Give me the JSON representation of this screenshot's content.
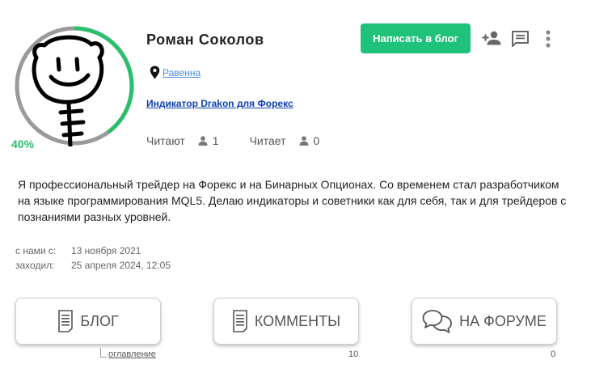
{
  "profile": {
    "name": "Роман Соколов",
    "progress_label": "40%",
    "progress": 0.4,
    "location": "Равенна",
    "product_link": "Индикатор Drakon для Форекс",
    "followers_label": "Читают",
    "followers_count": "1",
    "following_label": "Читает",
    "following_count": "0",
    "bio": "Я профессиональный трейдер на Форекс и на Бинарных Опционах. Со временем стал разработчиком на языке программирования MQL5. Делаю индикаторы и советники как для себя, так и для трейдеров с познаниями разных уровней.",
    "meta": [
      {
        "key": "с нами с:",
        "value": "13 ноября 2021"
      },
      {
        "key": "заходил:",
        "value": "25 апреля 2024, 12:05"
      }
    ]
  },
  "actions": {
    "write_blog": "Написать в блог",
    "icons": [
      "add-friend-icon",
      "message-icon",
      "more-vertical-icon"
    ]
  },
  "tabs": {
    "blog": {
      "label": "БЛОГ",
      "sub_link": "оглавление"
    },
    "comments": {
      "label": "КОММЕНТЫ",
      "count": "10"
    },
    "forum": {
      "label": "НА ФОРУМЕ",
      "count": "0"
    }
  },
  "colors": {
    "accent": "#1fc27a",
    "progress": "#2bbf6b",
    "link": "#4a8ad8",
    "product_link": "#0b3fb5"
  }
}
